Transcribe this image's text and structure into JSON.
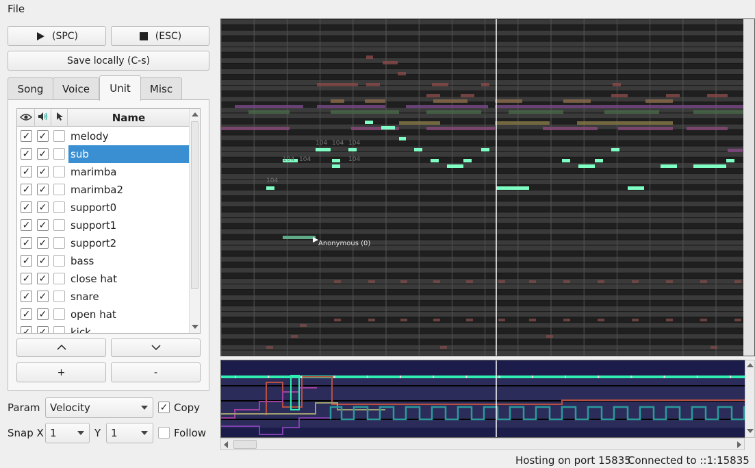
{
  "menu": {
    "file": "File"
  },
  "transport": {
    "play_label": "(SPC)",
    "stop_label": "(ESC)"
  },
  "save_label": "Save locally (C-s)",
  "tabs": [
    {
      "label": "Song"
    },
    {
      "label": "Voice"
    },
    {
      "label": "Unit",
      "active": true
    },
    {
      "label": "Misc"
    }
  ],
  "units_table": {
    "header": {
      "name": "Name"
    },
    "rows": [
      {
        "name": "melody",
        "visible": true,
        "audible": true,
        "edit": false
      },
      {
        "name": "sub",
        "visible": true,
        "audible": true,
        "edit": false,
        "selected": true
      },
      {
        "name": "marimba",
        "visible": true,
        "audible": true,
        "edit": false
      },
      {
        "name": "marimba2",
        "visible": true,
        "audible": true,
        "edit": false
      },
      {
        "name": "support0",
        "visible": true,
        "audible": true,
        "edit": false
      },
      {
        "name": "support1",
        "visible": true,
        "audible": true,
        "edit": false
      },
      {
        "name": "support2",
        "visible": true,
        "audible": true,
        "edit": false
      },
      {
        "name": "bass",
        "visible": true,
        "audible": true,
        "edit": false
      },
      {
        "name": "close hat",
        "visible": true,
        "audible": true,
        "edit": false
      },
      {
        "name": "snare",
        "visible": true,
        "audible": true,
        "edit": false
      },
      {
        "name": "open hat",
        "visible": true,
        "audible": true,
        "edit": false
      },
      {
        "name": "kick",
        "visible": true,
        "audible": true,
        "edit": false
      }
    ]
  },
  "unit_buttons": {
    "up": "^",
    "down": "v",
    "add": "+",
    "remove": "-"
  },
  "param": {
    "label": "Param",
    "value": "Velocity",
    "copy_label": "Copy",
    "copy_checked": true
  },
  "snap": {
    "x_label": "Snap X",
    "x_value": "1",
    "y_label": "Y",
    "y_value": "1",
    "follow_label": "Follow",
    "follow_checked": false
  },
  "roll": {
    "cursor_label": "Anonymous (0)",
    "note_labels": [
      "104",
      "104",
      "104",
      "104",
      "104",
      "104",
      "104"
    ],
    "colors": {
      "active_note": "#7fffc4",
      "other_note": "#8a5a5a",
      "background": "#2a2a2a"
    }
  },
  "status": {
    "hosting": "Hosting on port 15835",
    "connected": "Connected to ::1:15835"
  }
}
